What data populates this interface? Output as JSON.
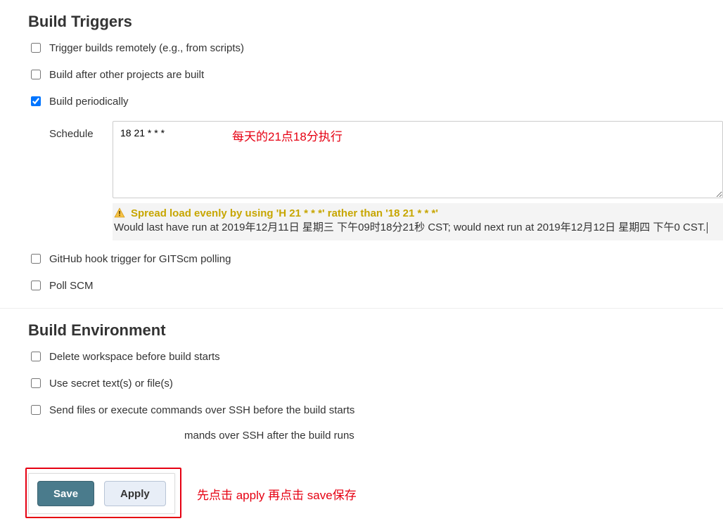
{
  "triggers": {
    "title": "Build Triggers",
    "remote": {
      "label": "Trigger builds remotely (e.g., from scripts)",
      "checked": false
    },
    "after": {
      "label": "Build after other projects are built",
      "checked": false
    },
    "periodic": {
      "label": "Build periodically",
      "checked": true
    },
    "schedule_label": "Schedule",
    "schedule_value": "18 21 * * *",
    "schedule_annotation": "每天的21点18分执行",
    "warn_text": "Spread load evenly by using 'H 21 * * *' rather than '18 21 * * *'",
    "info_text": "Would last have run at 2019年12月11日 星期三 下午09时18分21秒 CST; would next run at 2019年12月12日 星期四 下午0 CST.",
    "github_hook": {
      "label": "GitHub hook trigger for GITScm polling",
      "checked": false
    },
    "poll_scm": {
      "label": "Poll SCM",
      "checked": false
    }
  },
  "environment": {
    "title": "Build Environment",
    "delete_ws": {
      "label": "Delete workspace before build starts",
      "checked": false
    },
    "secrets": {
      "label": "Use secret text(s) or file(s)",
      "checked": false
    },
    "ssh_before": {
      "label": "Send files or execute commands over SSH before the build starts",
      "checked": false
    },
    "ssh_after": {
      "label": "mands over SSH after the build runs",
      "checked": false
    }
  },
  "footer": {
    "save": "Save",
    "apply": "Apply",
    "annotation": "先点击 apply 再点击 save保存"
  }
}
